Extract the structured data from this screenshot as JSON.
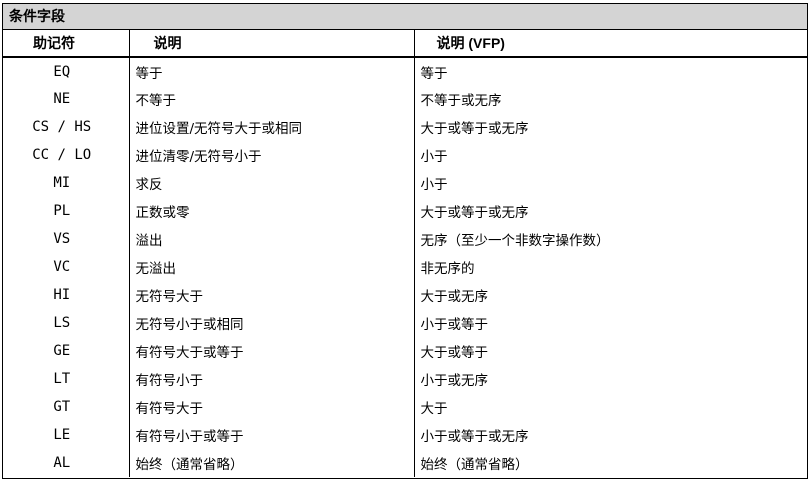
{
  "title": "条件字段",
  "headers": {
    "mnemonic": "助记符",
    "description": "说明",
    "description_vfp": "说明 (VFP)"
  },
  "rows": [
    {
      "mnemonic": "EQ",
      "description": "等于",
      "description_vfp": "等于"
    },
    {
      "mnemonic": "NE",
      "description": "不等于",
      "description_vfp": "不等于或无序"
    },
    {
      "mnemonic": "CS / HS",
      "description": "进位设置/无符号大于或相同",
      "description_vfp": "大于或等于或无序"
    },
    {
      "mnemonic": "CC / LO",
      "description": "进位清零/无符号小于",
      "description_vfp": "小于"
    },
    {
      "mnemonic": "MI",
      "description": "求反",
      "description_vfp": "小于"
    },
    {
      "mnemonic": "PL",
      "description": "正数或零",
      "description_vfp": "大于或等于或无序"
    },
    {
      "mnemonic": "VS",
      "description": "溢出",
      "description_vfp": "无序（至少一个非数字操作数）"
    },
    {
      "mnemonic": "VC",
      "description": "无溢出",
      "description_vfp": "非无序的"
    },
    {
      "mnemonic": "HI",
      "description": "无符号大于",
      "description_vfp": "大于或无序"
    },
    {
      "mnemonic": "LS",
      "description": "无符号小于或相同",
      "description_vfp": "小于或等于"
    },
    {
      "mnemonic": "GE",
      "description": "有符号大于或等于",
      "description_vfp": "大于或等于"
    },
    {
      "mnemonic": "LT",
      "description": "有符号小于",
      "description_vfp": "小于或无序"
    },
    {
      "mnemonic": "GT",
      "description": "有符号大于",
      "description_vfp": "大于"
    },
    {
      "mnemonic": "LE",
      "description": "有符号小于或等于",
      "description_vfp": "小于或等于或无序"
    },
    {
      "mnemonic": "AL",
      "description": "始终（通常省略）",
      "description_vfp": "始终（通常省略）"
    }
  ]
}
